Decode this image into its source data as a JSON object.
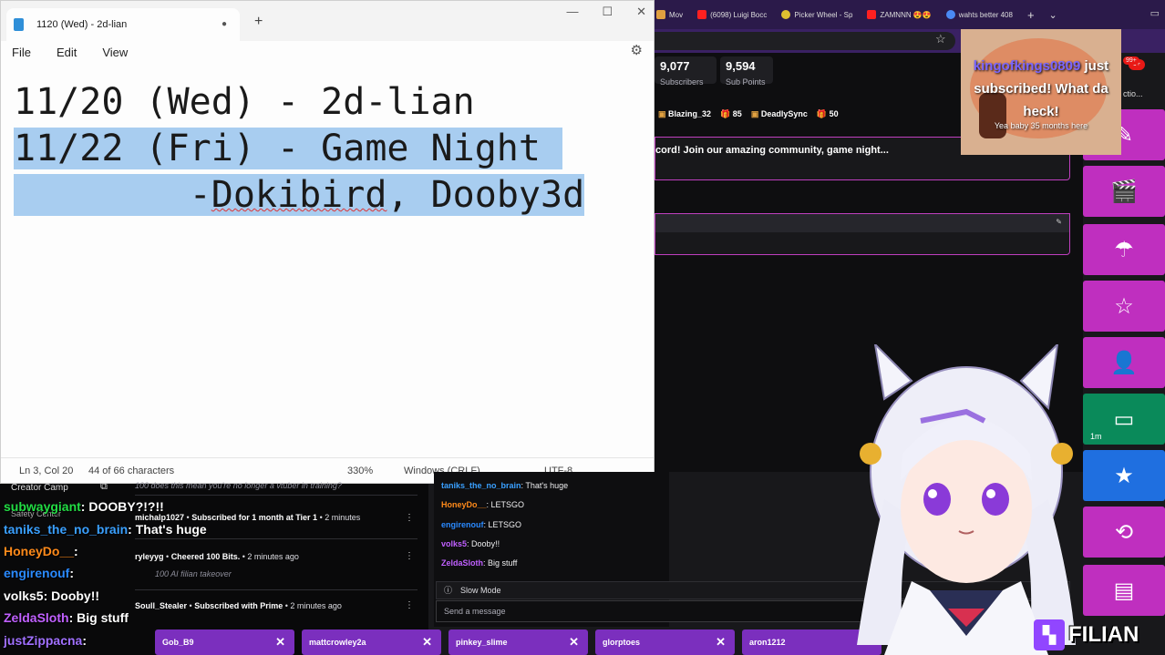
{
  "notepad": {
    "tab_title": "1120 (Wed) - 2d-lian",
    "menu": [
      "File",
      "Edit",
      "View"
    ],
    "lines": [
      "11/20 (Wed) - 2d-lian",
      "11/22 (Fri) - Game Night",
      "        -Dokibird, Dooby3d"
    ],
    "squiggle_word": "Dokibird",
    "status": {
      "position": "Ln 3, Col 20",
      "chars": "44 of 66 characters",
      "zoom": "330%",
      "eol": "Windows (CRLF)",
      "encoding": "UTF-8"
    }
  },
  "browser": {
    "tabs": [
      {
        "label": "Mov",
        "icon": "pizza-icon",
        "color": "#e0a040"
      },
      {
        "label": "(6098) Luigi Bocc",
        "icon": "youtube-icon",
        "color": "#ff2020"
      },
      {
        "label": "Picker Wheel - Sp",
        "icon": "wheel-icon",
        "color": "#e0c030"
      },
      {
        "label": "ZAMNNN 😍😍",
        "icon": "youtube-icon",
        "color": "#ff2020"
      },
      {
        "label": "wahts better 408",
        "icon": "google-icon",
        "color": "#4a8af4"
      }
    ],
    "new_tab": "+",
    "dropdown": "⌄"
  },
  "dashboard": {
    "subscribers_value": "9,077",
    "subscribers_label": "Subscribers",
    "subpoints_value": "9,594",
    "subpoints_label": "Sub Points",
    "leader1_name": "Blazing_32",
    "leader1_count": "85",
    "leader2_name": "DeadlySync",
    "leader2_count": "50",
    "promo": "cord! Join our amazing community, game night...",
    "badge_top1": "9+",
    "badge_top2": "99+",
    "action_label": "ctio..."
  },
  "alert": {
    "name": "kingofkings0809",
    "text": " just subscribed! What da heck!",
    "subtext": "Yea baby 35 months here"
  },
  "actions": [
    {
      "icon": "pencil-icon",
      "glyph": "✎",
      "color": "#bf2fbf"
    },
    {
      "icon": "clapper-icon",
      "glyph": "🎬",
      "color": "#bf2fbf"
    },
    {
      "icon": "umbrella-icon",
      "glyph": "☂",
      "color": "#bf2fbf"
    },
    {
      "icon": "star-icon",
      "glyph": "☆",
      "color": "#bf2fbf"
    },
    {
      "icon": "add-user-icon",
      "glyph": "👤",
      "color": "#bf2fbf"
    },
    {
      "icon": "ad-icon",
      "glyph": "▭",
      "color": "#0a8a5a",
      "timer": "1m"
    },
    {
      "icon": "star-filled-icon",
      "glyph": "★",
      "color": "#1f6fe0"
    },
    {
      "icon": "replay-icon",
      "glyph": "⟲",
      "color": "#bf2fbf"
    },
    {
      "icon": "layout-icon",
      "glyph": "▤",
      "color": "#bf2fbf"
    }
  ],
  "overlay_chat": {
    "creator_camp": "Creator Camp",
    "safety_center": "Safety Center",
    "lines": [
      {
        "user": "subwaygiant",
        "color": "#22dd44",
        "msg": "DOOBY?!?!!"
      },
      {
        "user": "taniks_the_no_brain",
        "color": "#3aa0ff",
        "msg": "That's huge"
      },
      {
        "user": "HoneyDo__",
        "color": "#ff8a1a",
        "msg": ""
      },
      {
        "user": "engirenouf",
        "color": "#2a8aff",
        "msg": ""
      },
      {
        "user": "volks5",
        "color": "#ffffff",
        "msg": "Dooby!!"
      },
      {
        "user": "ZeldaSloth",
        "color": "#c060ff",
        "msg": "Big stuff"
      },
      {
        "user": "justZippacna",
        "color": "#a070ff",
        "msg": ""
      }
    ]
  },
  "activity_feed": [
    {
      "user": "",
      "action": "",
      "time": "",
      "sub": "100 does this mean you're no longer a vtuber in training?"
    },
    {
      "user": "michalp1027",
      "action": "Subscribed for 1 month at Tier 1",
      "time": "• 2 minutes",
      "sub": ""
    },
    {
      "user": "ryleyyg",
      "action": "Cheered 100 Bits.",
      "time": "• 2 minutes ago",
      "sub": "100 AI filian takeover"
    },
    {
      "user": "Soull_Stealer",
      "action": "Subscribed with Prime",
      "time": "• 2 minutes ago",
      "sub": ""
    }
  ],
  "chat": {
    "lines": [
      {
        "user": "taniks_the_no_brain",
        "color": "#3aa0ff",
        "msg": "That's huge"
      },
      {
        "user": "HoneyDo__",
        "color": "#ff8a1a",
        "msg": "LETSGO"
      },
      {
        "user": "engirenouf",
        "color": "#2a8aff",
        "msg": "LETSGO"
      },
      {
        "user": "volks5",
        "color": "#c060ff",
        "msg": "Dooby!!"
      },
      {
        "user": "ZeldaSloth",
        "color": "#c060ff",
        "msg": "Big stuff"
      }
    ],
    "slow_mode": "Slow Mode",
    "send_placeholder": "Send a message"
  },
  "bottom_tabs": [
    "Gob_B9",
    "mattcrowley2a",
    "pinkey_slime",
    "glorptoes",
    "aron1212"
  ],
  "brand": {
    "text": "FILIAN"
  }
}
